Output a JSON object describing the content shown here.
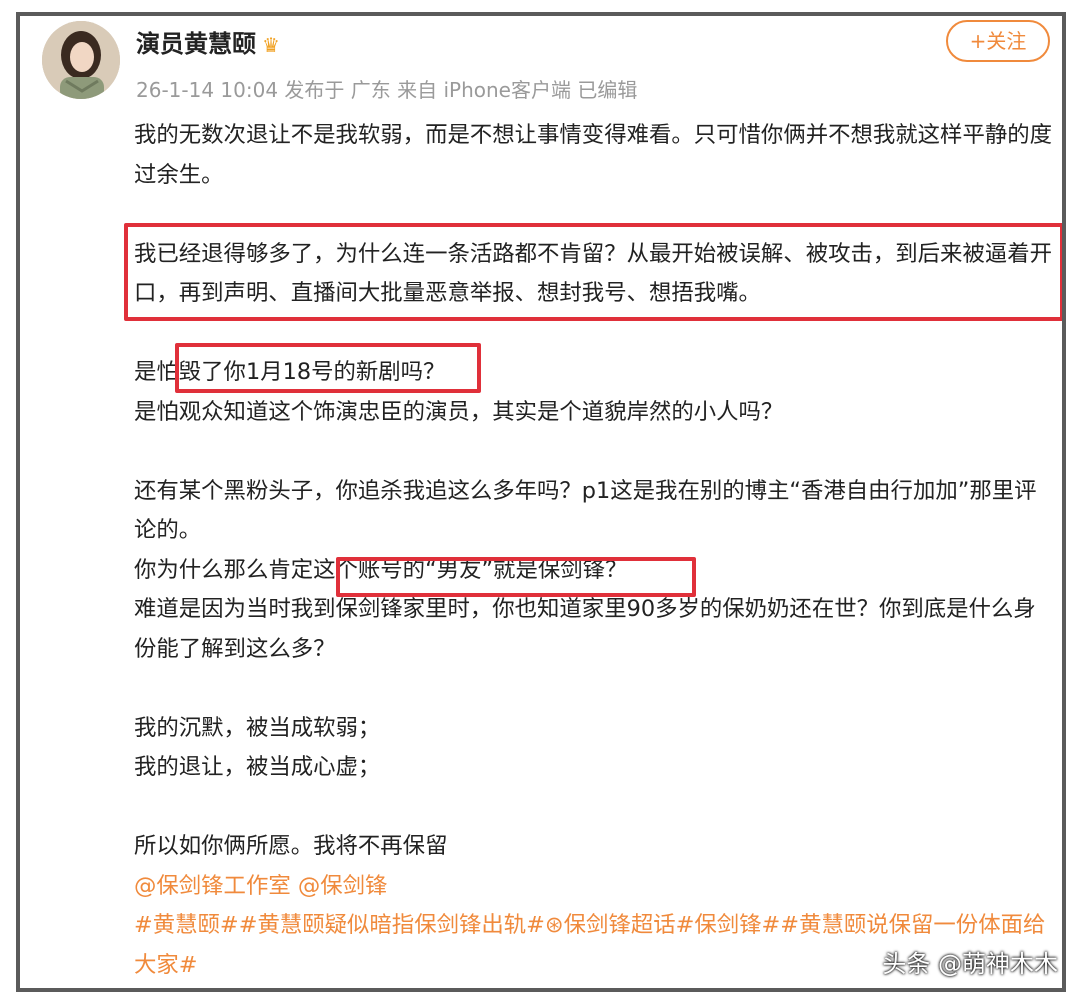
{
  "post": {
    "author": "演员黄慧颐",
    "meta": "26-1-14 10:04 发布于 广东 来自 iPhone客户端 已编辑",
    "follow_label": "+关注"
  },
  "content": {
    "p1": "我的无数次退让不是我软弱，而是不想让事情变得难看。只可惜你俩并不想我就这样平静的度过余生。",
    "p2": "我已经退得够多了，为什么连一条活路都不肯留？从最开始被误解、被攻击，到后来被逼着开口，再到声明、直播间大批量恶意举报、想封我号、想捂我嘴。",
    "p3a": "是怕毁了你1月18号的新剧吗？",
    "p3b": "是怕观众知道这个饰演忠臣的演员，其实是个道貌岸然的小人吗？",
    "p4a": "还有某个黑粉头子，你追杀我追这么多年吗？p1这是我在别的博主“香港自由行加加”那里评论的。",
    "p4b": "你为什么那么肯定这个账号的“男友”就是保剑锋？",
    "p4c": "难道是因为当时我到保剑锋家里时，你也知道家里90多岁的保奶奶还在世？你到底是什么身份能了解到这么多？",
    "p5a": "我的沉默，被当成软弱；",
    "p5b": "我的退让，被当成心虚；",
    "p6": "所以如你俩所愿。我将不再保留",
    "mentions": "@保剑锋工作室 @保剑锋",
    "hashtags": "#黄慧颐##黄慧颐疑似暗指保剑锋出轨#⊛保剑锋超话#保剑锋##黄慧颐说保留一份体面给大家#"
  },
  "watermark": "头条 @萌神木木",
  "colors": {
    "accent": "#f08a3c",
    "highlight": "#e0303a"
  }
}
